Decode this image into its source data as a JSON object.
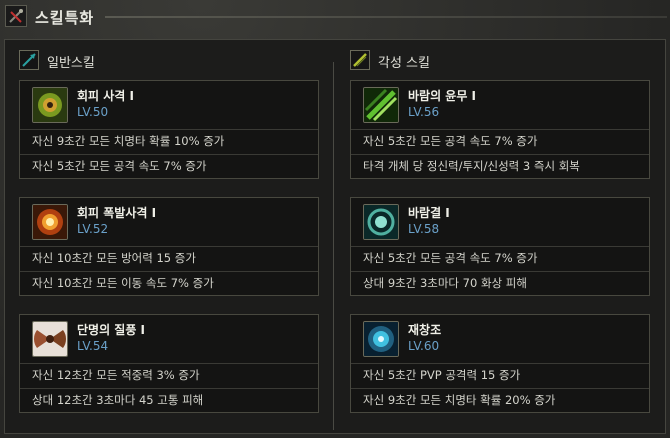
{
  "header": {
    "title": "스킬특화"
  },
  "colors": {
    "level": "#6aa0c8",
    "accent_left": "#2aa0a0",
    "accent_right": "#b0c030"
  },
  "columns": [
    {
      "title": "일반스킬",
      "icon": "arrow-icon",
      "cards": [
        {
          "name": "회피 사격 I",
          "level": "LV.50",
          "icon": "green-orb-icon",
          "effects": [
            "자신 9초간 모든 치명타 확률 10% 증가",
            "자신 5초간 모든 공격 속도 7% 증가"
          ]
        },
        {
          "name": "회피 폭발사격 I",
          "level": "LV.52",
          "icon": "fire-burst-icon",
          "effects": [
            "자신 10초간 모든 방어력 15 증가",
            "자신 10초간 모든 이동 속도 7% 증가"
          ]
        },
        {
          "name": "단명의 질풍 I",
          "level": "LV.54",
          "icon": "whirlwind-icon",
          "effects": [
            "자신 12초간 모든 적중력 3% 증가",
            "상대 12초간 3초마다 45 고통 피해"
          ]
        }
      ]
    },
    {
      "title": "각성 스킬",
      "icon": "sword-icon",
      "cards": [
        {
          "name": "바람의 윤무 I",
          "level": "LV.56",
          "icon": "green-slash-icon",
          "effects": [
            "자신 5초간 모든 공격 속도 7% 증가",
            "타격 개체 당 정신력/투지/신성력 3 즉시 회복"
          ]
        },
        {
          "name": "바람결 I",
          "level": "LV.58",
          "icon": "wind-swirl-icon",
          "effects": [
            "자신 5초간 모든 공격 속도 7% 증가",
            "상대 9초간 3초마다 70 화상 피해"
          ]
        },
        {
          "name": "재창조",
          "level": "LV.60",
          "icon": "cyan-vortex-icon",
          "effects": [
            "자신 5초간 PVP 공격력 15 증가",
            "자신 9초간 모든 치명타 확률 20% 증가"
          ]
        }
      ]
    }
  ]
}
